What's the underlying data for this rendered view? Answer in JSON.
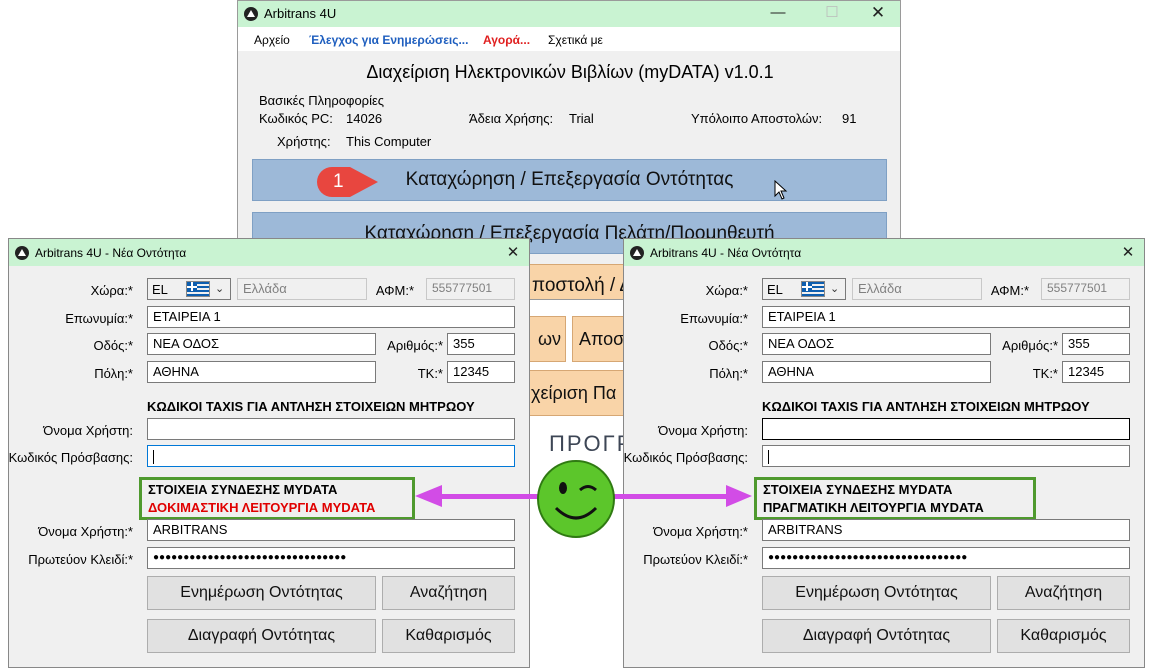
{
  "main_window": {
    "title": "Arbitrans 4U",
    "menu": [
      {
        "label": "Αρχείο",
        "color": "#000000"
      },
      {
        "label": "Έλεγχος για Ενημερώσεις...",
        "color": "#1f5fbf"
      },
      {
        "label": "Αγορά...",
        "color": "#e02020"
      },
      {
        "label": "Σχετικά με",
        "color": "#000000"
      }
    ],
    "heading": "Διαχείριση Ηλεκτρονικών Βιβλίων (myDATA) v1.0.1",
    "info": {
      "group_label": "Βασικές Πληροφορίες",
      "pc_code_label": "Κωδικός PC:",
      "pc_code": "14026",
      "license_label": "Άδεια Χρήσης:",
      "license": "Trial",
      "remaining_label": "Υπόλοιπο Αποστολών:",
      "remaining": "91",
      "user_label": "Χρήστης:",
      "user": "This Computer"
    },
    "buttons": {
      "entity": "Καταχώρηση / Επεξεργασία Οντότητας",
      "client": "Καταχώρηση / Επεξεργασία Πελάτη/Προμηθευτή",
      "send_partial": "ποστολή / Δ",
      "small_a": "ων",
      "small_b": "Αποσ",
      "manage_partial": "χείριση Πα",
      "program_partial": "ΠΡΟΓΡ"
    },
    "callout": "1"
  },
  "dialogs": [
    {
      "title": "Arbitrans 4U - Νέα Οντότητα",
      "country_label": "Χώρα:*",
      "country_code": "EL",
      "country_name": "Ελλάδα",
      "vat_label": "ΑΦΜ:*",
      "vat": "555777501",
      "surname_label": "Επωνυμία:*",
      "surname": "ΕΤΑΙΡΕΙΑ 1",
      "street_label": "Οδός:*",
      "street": "ΝΕΑ ΟΔΟΣ",
      "number_label": "Αριθμός:*",
      "number": "355",
      "city_label": "Πόλη:*",
      "city": "ΑΘΗΝΑ",
      "zip_label": "ΤΚ:*",
      "zip": "12345",
      "taxis_title": "ΚΩΔΙΚΟΙ TAXIS ΓΙΑ ΑΝΤΛΗΣΗ ΣΤΟΙΧΕΙΩΝ ΜΗΤΡΩΟΥ",
      "taxis_user_label": "Όνομα Χρήστη:",
      "taxis_pass_label": "Κωδικός Πρόσβασης:",
      "mydata_title": "ΣΤΟΙΧΕΙΑ ΣΥΝΔΕΣΗΣ MYDATA",
      "mydata_mode": "ΔΟΚΙΜΑΣΤΙΚΗ ΛΕΙΤΟΥΡΓΙΑ MYDATA",
      "mydata_mode_color": "#e00000",
      "md_user_label": "Όνομα Χρήστη:*",
      "md_user": "ARBITRANS",
      "md_key_label": "Πρωτεύον Κλειδί:*",
      "md_key": "●●●●●●●●●●●●●●●●●●●●●●●●●●●●●●●●",
      "btn_update": "Ενημέρωση Οντότητας",
      "btn_search": "Αναζήτηση",
      "btn_delete": "Διαγραφή Οντότητας",
      "btn_clear": "Καθαρισμός"
    },
    {
      "title": "Arbitrans 4U - Νέα Οντότητα",
      "country_label": "Χώρα:*",
      "country_code": "EL",
      "country_name": "Ελλάδα",
      "vat_label": "ΑΦΜ:*",
      "vat": "555777501",
      "surname_label": "Επωνυμία:*",
      "surname": "ΕΤΑΙΡΕΙΑ 1",
      "street_label": "Οδός:*",
      "street": "ΝΕΑ ΟΔΟΣ",
      "number_label": "Αριθμός:*",
      "number": "355",
      "city_label": "Πόλη:*",
      "city": "ΑΘΗΝΑ",
      "zip_label": "ΤΚ:*",
      "zip": "12345",
      "taxis_title": "ΚΩΔΙΚΟΙ TAXIS ΓΙΑ ΑΝΤΛΗΣΗ ΣΤΟΙΧΕΙΩΝ ΜΗΤΡΩΟΥ",
      "taxis_user_label": "Όνομα Χρήστη:",
      "taxis_pass_label": "Κωδικός Πρόσβασης:",
      "mydata_title": "ΣΤΟΙΧΕΙΑ ΣΥΝΔΕΣΗΣ MYDATA",
      "mydata_mode": "ΠΡΑΓΜΑΤΙΚΗ ΛΕΙΤΟΥΡΓΙΑ MYDATA",
      "mydata_mode_color": "#000000",
      "md_user_label": "Όνομα Χρήστη:*",
      "md_user": "ARBITRANS",
      "md_key_label": "Πρωτεύον Κλειδί:*",
      "md_key": "●●●●●●●●●●●●●●●●●●●●●●●●●●●●●●●●●",
      "btn_update": "Ενημέρωση Οντότητας",
      "btn_search": "Αναζήτηση",
      "btn_delete": "Διαγραφή Οντότητας",
      "btn_clear": "Καθαρισμός"
    }
  ],
  "colors": {
    "titlebar": "#c9f3d2",
    "primary_button": "#9db9d8",
    "annotation_arrow": "#d24ce6",
    "highlight_box": "#4f9a2e",
    "callout": "#e8463f",
    "smiley": "#5cc62b"
  }
}
